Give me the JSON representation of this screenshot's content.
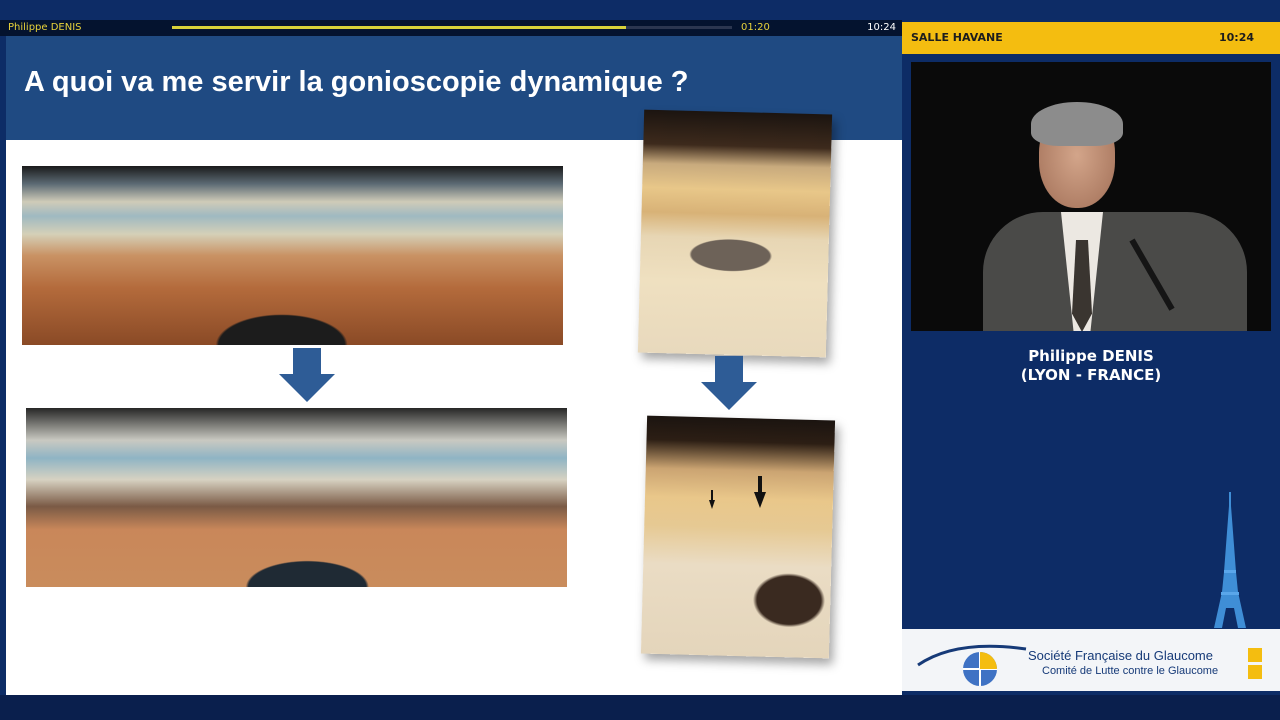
{
  "player": {
    "speaker": "Philippe DENIS",
    "elapsed": "01:20",
    "clock": "10:24",
    "progress_fraction": 0.81
  },
  "slide": {
    "title": "A quoi va me servir la gonioscopie dynamique ?"
  },
  "session": {
    "room": "SALLE HAVANE",
    "clock": "10:24"
  },
  "presenter": {
    "name": "Philippe DENIS",
    "location": "(LYON - FRANCE)"
  },
  "sponsor": {
    "line1": "Société Française du Glaucome",
    "line2": "Comité de Lutte contre le Glaucome"
  },
  "colors": {
    "accent": "#f4bd10",
    "slide_header": "#1f4a82",
    "background": "#0d2c66",
    "arrow": "#2e5c96"
  },
  "icons": {
    "down_arrow": "down-arrow-icon",
    "pointer_arrow": "pointer-arrow-icon",
    "eiffel_tower": "eiffel-tower-icon",
    "sfg_logo": "sfg-logo-icon"
  }
}
